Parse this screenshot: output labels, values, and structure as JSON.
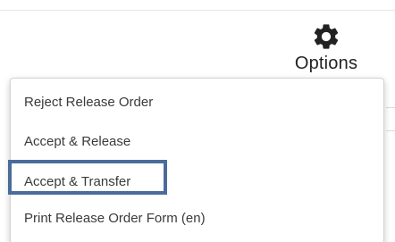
{
  "options_button": {
    "icon": "gear-icon",
    "label": "Options"
  },
  "menu": {
    "items": [
      {
        "label": "Reject Release Order"
      },
      {
        "label": "Accept & Release"
      },
      {
        "label": "Accept & Transfer",
        "highlighted": true
      },
      {
        "label": "Print Release Order Form (en)"
      }
    ]
  },
  "colors": {
    "highlight_border": "#4a6c9a",
    "text": "#3a3a3a",
    "menu_border": "#d4d4d4"
  }
}
